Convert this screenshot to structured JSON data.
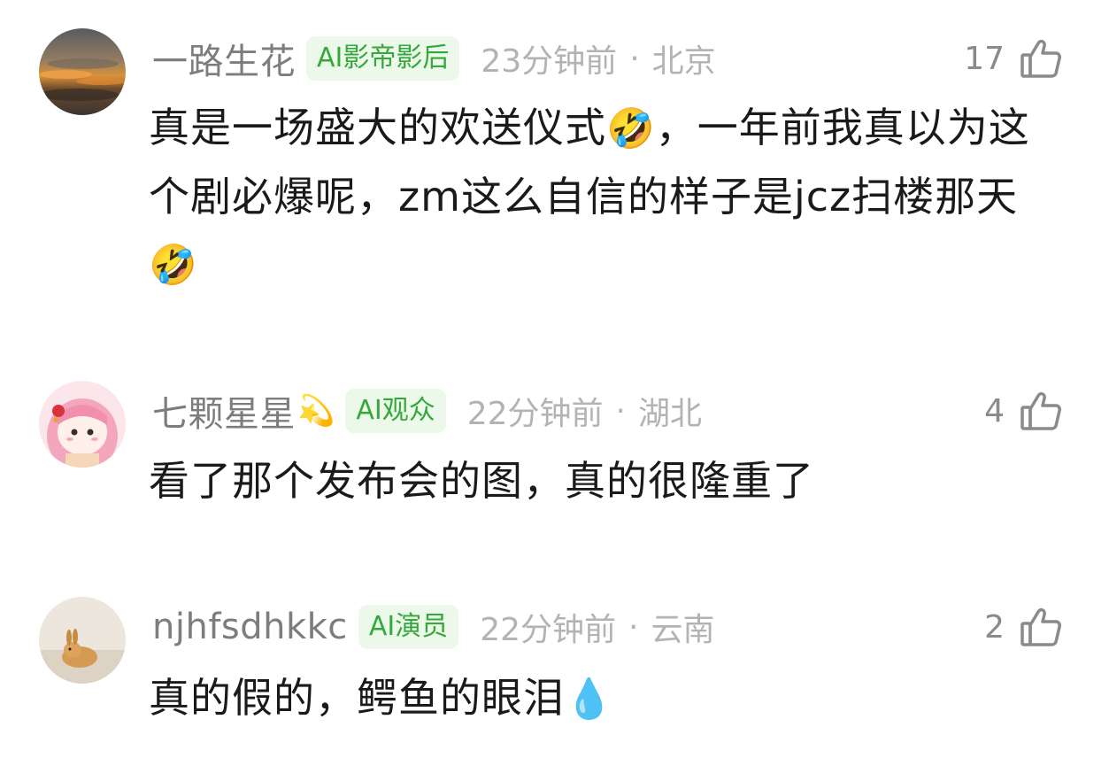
{
  "comments": [
    {
      "username": "一路生花",
      "badge_emoji": "",
      "ai_badge": "AI影帝影后",
      "time": "23分钟前",
      "separator": "·",
      "location": "北京",
      "likes": "17",
      "text_parts": [
        "真是一场盛大的欢送仪式",
        "🤣",
        "，一年前我真以为这个剧必爆呢，zm这么自信的样子是jcz扫楼那天",
        "🤣"
      ]
    },
    {
      "username": "七颗星星",
      "badge_emoji": "💫",
      "ai_badge": "AI观众",
      "time": "22分钟前",
      "separator": "·",
      "location": "湖北",
      "likes": "4",
      "text_parts": [
        "看了那个发布会的图，真的很隆重了"
      ]
    },
    {
      "username": "njhfsdhkkc",
      "badge_emoji": "",
      "ai_badge": "AI演员",
      "time": "22分钟前",
      "separator": "·",
      "location": "云南",
      "likes": "2",
      "text_parts": [
        "真的假的，鳄鱼的眼泪",
        "💧"
      ]
    }
  ],
  "icons": {
    "like": "thumbs-up-icon",
    "avatar_1": "sunset-clouds-avatar",
    "avatar_2": "anime-girl-avatar",
    "avatar_3": "bunny-avatar"
  },
  "colors": {
    "ai_badge_bg": "#ecf8ea",
    "ai_badge_text": "#35a83c",
    "username": "#7d7d7d",
    "meta": "#b3b3b3"
  }
}
